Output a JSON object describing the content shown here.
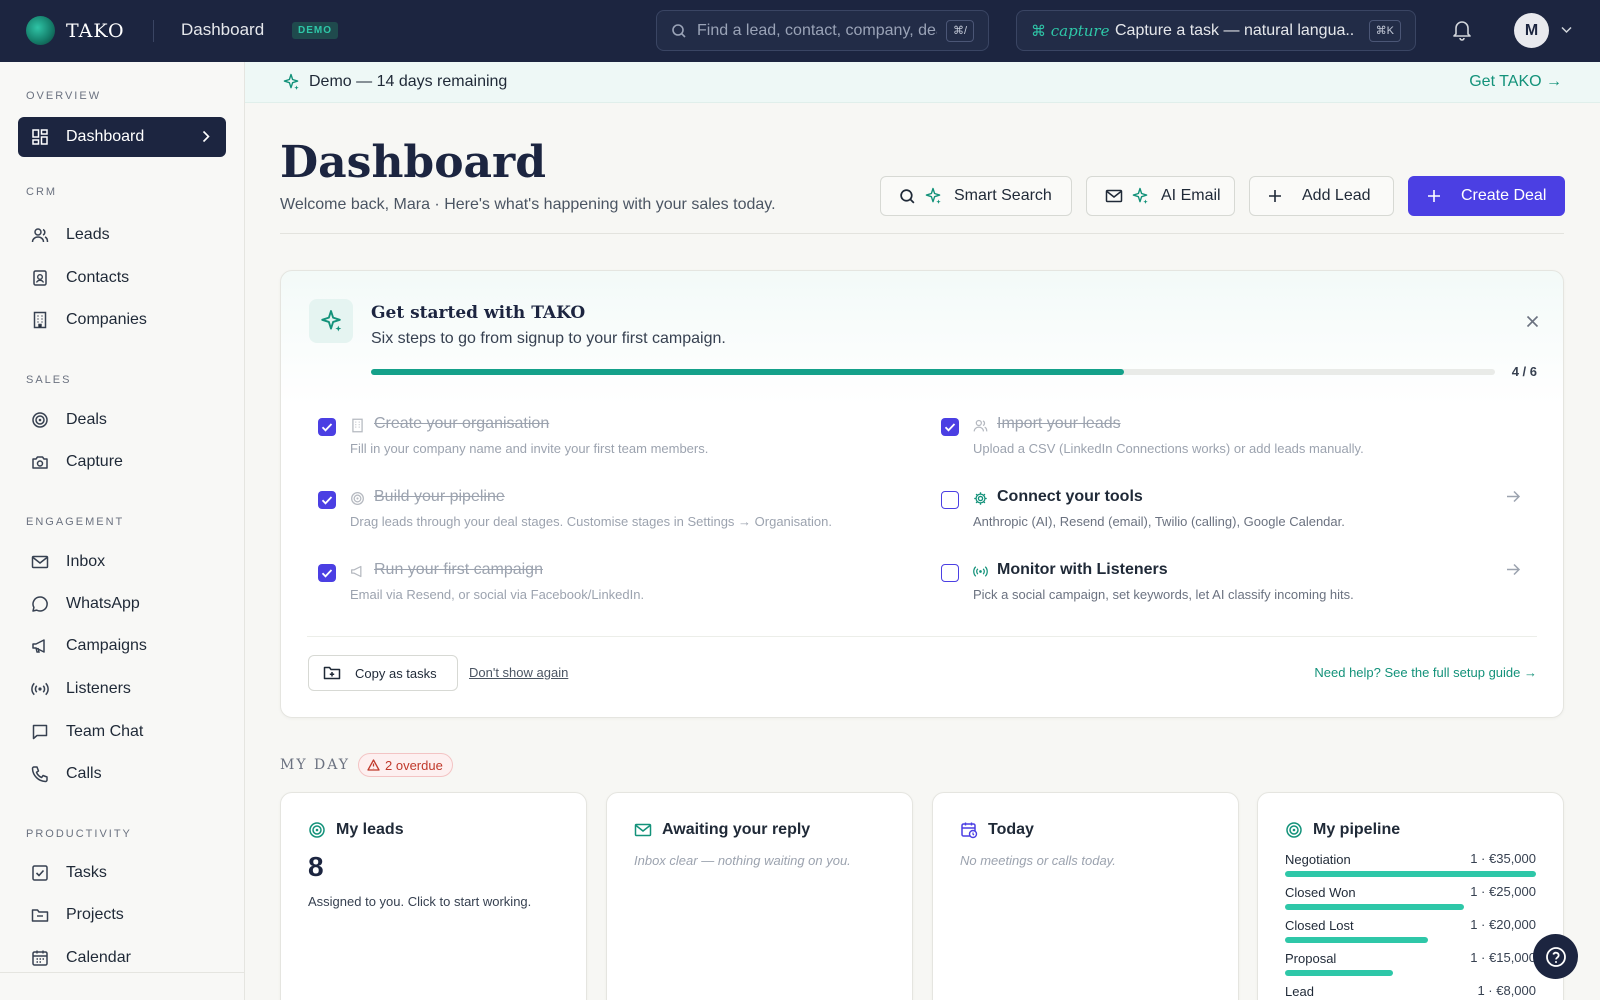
{
  "topbar": {
    "logo_text": "TAKO",
    "title": "Dashboard",
    "demo_badge": "DEMO",
    "search": {
      "placeholder": "Find a lead, contact, company, deal…",
      "shortcut": "⌘/"
    },
    "capture": {
      "tag": "⌘ capture",
      "text": "Capture a task — natural langua...",
      "shortcut": "⌘K"
    },
    "avatar_initial": "M"
  },
  "sidebar": {
    "sections": {
      "overview": "OVERVIEW",
      "crm": "CRM",
      "sales": "SALES",
      "engagement": "ENGAGEMENT",
      "productivity": "PRODUCTIVITY"
    },
    "items": {
      "dashboard": "Dashboard",
      "leads": "Leads",
      "contacts": "Contacts",
      "companies": "Companies",
      "deals": "Deals",
      "capture": "Capture",
      "inbox": "Inbox",
      "whatsapp": "WhatsApp",
      "campaigns": "Campaigns",
      "listeners": "Listeners",
      "team_chat": "Team Chat",
      "calls": "Calls",
      "tasks": "Tasks",
      "projects": "Projects",
      "calendar": "Calendar"
    }
  },
  "banner": {
    "text": "Demo — 14 days remaining",
    "link": "Get TAKO →"
  },
  "header": {
    "title": "Dashboard",
    "subtitle": "Welcome back, Mara · Here's what's happening with your sales today.",
    "buttons": {
      "smart_search": "Smart Search",
      "ai_email": "AI Email",
      "add_lead": "Add Lead",
      "create_deal": "Create Deal"
    }
  },
  "getting_started": {
    "title": "Get started with TAKO",
    "subtitle": "Six steps to go from signup to your first campaign.",
    "progress_text": "4 / 6",
    "progress_fraction": 0.67,
    "steps": [
      {
        "title": "Create your organisation",
        "desc": "Fill in your company name and invite your first team members.",
        "done": true
      },
      {
        "title": "Import your leads",
        "desc": "Upload a CSV (LinkedIn Connections works) or add leads manually.",
        "done": true
      },
      {
        "title": "Build your pipeline",
        "desc": "Drag leads through your deal stages. Customise stages in Settings → Organisation.",
        "done": true
      },
      {
        "title": "Connect your tools",
        "desc": "Anthropic (AI), Resend (email), Twilio (calling), Google Calendar.",
        "done": false
      },
      {
        "title": "Run your first campaign",
        "desc": "Email via Resend, or social via Facebook/LinkedIn.",
        "done": true
      },
      {
        "title": "Monitor with Listeners",
        "desc": "Pick a social campaign, set keywords, let AI classify incoming hits.",
        "done": false
      }
    ],
    "copy_button": "Copy as tasks",
    "dont_show": "Don't show again",
    "help_link": "Need help? See the full setup guide →"
  },
  "my_day": {
    "label": "MY DAY",
    "overdue": "2 overdue",
    "my_leads": {
      "title": "My leads",
      "count": "8",
      "hint": "Assigned to you. Click to start working."
    },
    "awaiting": {
      "title": "Awaiting your reply",
      "empty": "Inbox clear — nothing waiting on you."
    },
    "today": {
      "title": "Today",
      "empty": "No meetings or calls today."
    },
    "pipeline": {
      "title": "My pipeline",
      "rows": [
        {
          "name": "Negotiation",
          "value": "1 · €35,000",
          "amount": 35000
        },
        {
          "name": "Closed Won",
          "value": "1 · €25,000",
          "amount": 25000
        },
        {
          "name": "Closed Lost",
          "value": "1 · €20,000",
          "amount": 20000
        },
        {
          "name": "Proposal",
          "value": "1 · €15,000",
          "amount": 15000
        },
        {
          "name": "Lead",
          "value": "1 · €8,000",
          "amount": 8000
        }
      ]
    }
  },
  "colors": {
    "accent": "#4b3fe3",
    "brand": "#13927a",
    "navy": "#1c2540"
  }
}
